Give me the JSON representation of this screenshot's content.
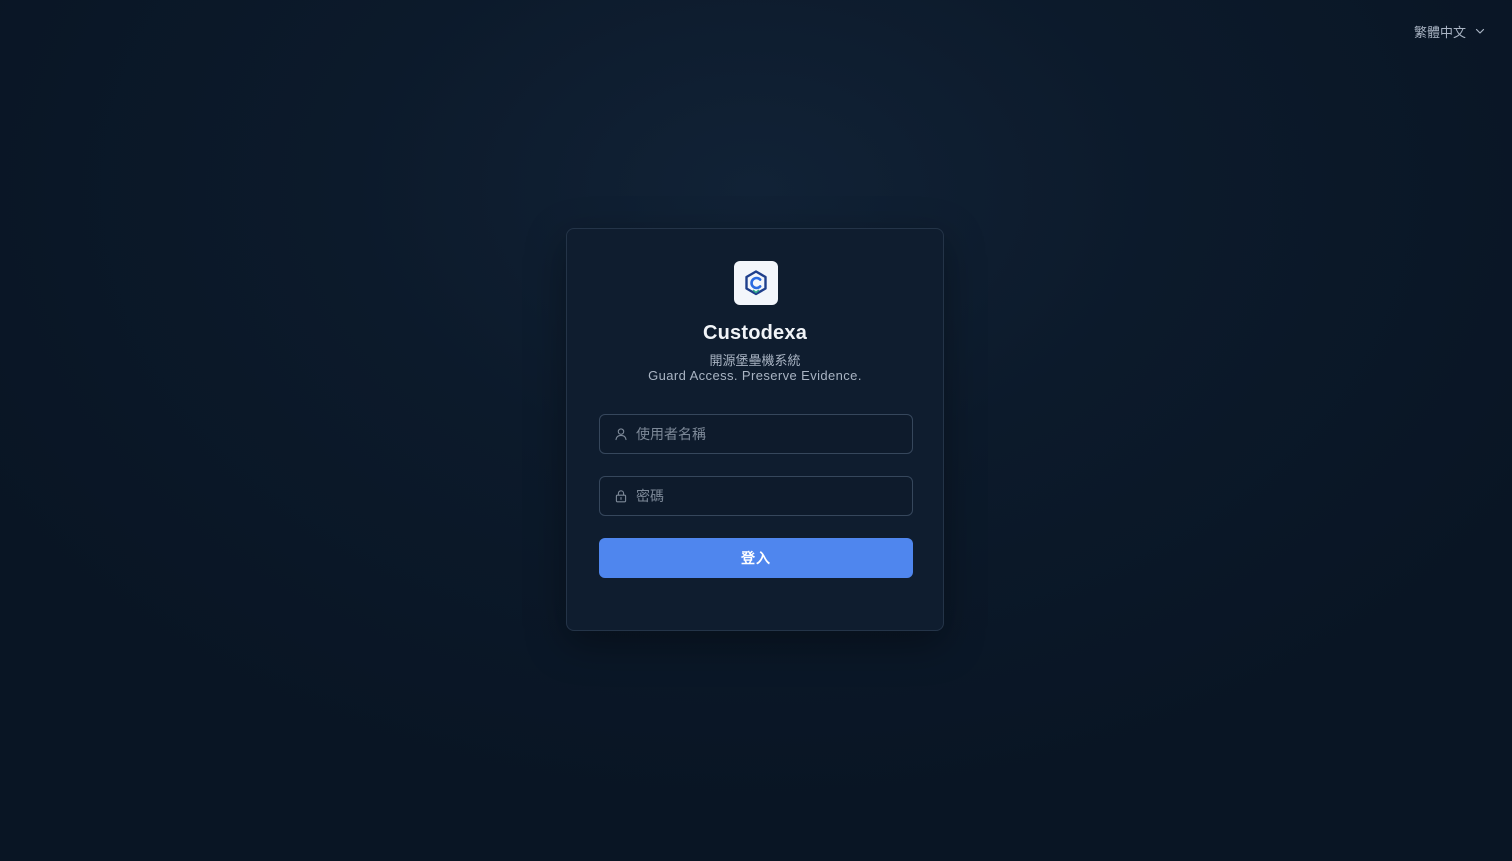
{
  "language_selector": {
    "label": "繁體中文",
    "icon": "chevron-down-icon"
  },
  "brand": {
    "logo_icon": "custodexa-logo-icon",
    "name": "Custodexa",
    "subtitle": "開源堡壘機系統",
    "tagline": "Guard Access. Preserve Evidence."
  },
  "form": {
    "username": {
      "placeholder": "使用者名稱",
      "value": "",
      "icon": "user-icon"
    },
    "password": {
      "placeholder": "密碼",
      "value": "",
      "icon": "lock-icon"
    },
    "submit_label": "登入"
  },
  "colors": {
    "background": "#0b1829",
    "card": "#0f1d2f",
    "primary": "#4f86ee",
    "text_muted": "#a9b4c3"
  }
}
